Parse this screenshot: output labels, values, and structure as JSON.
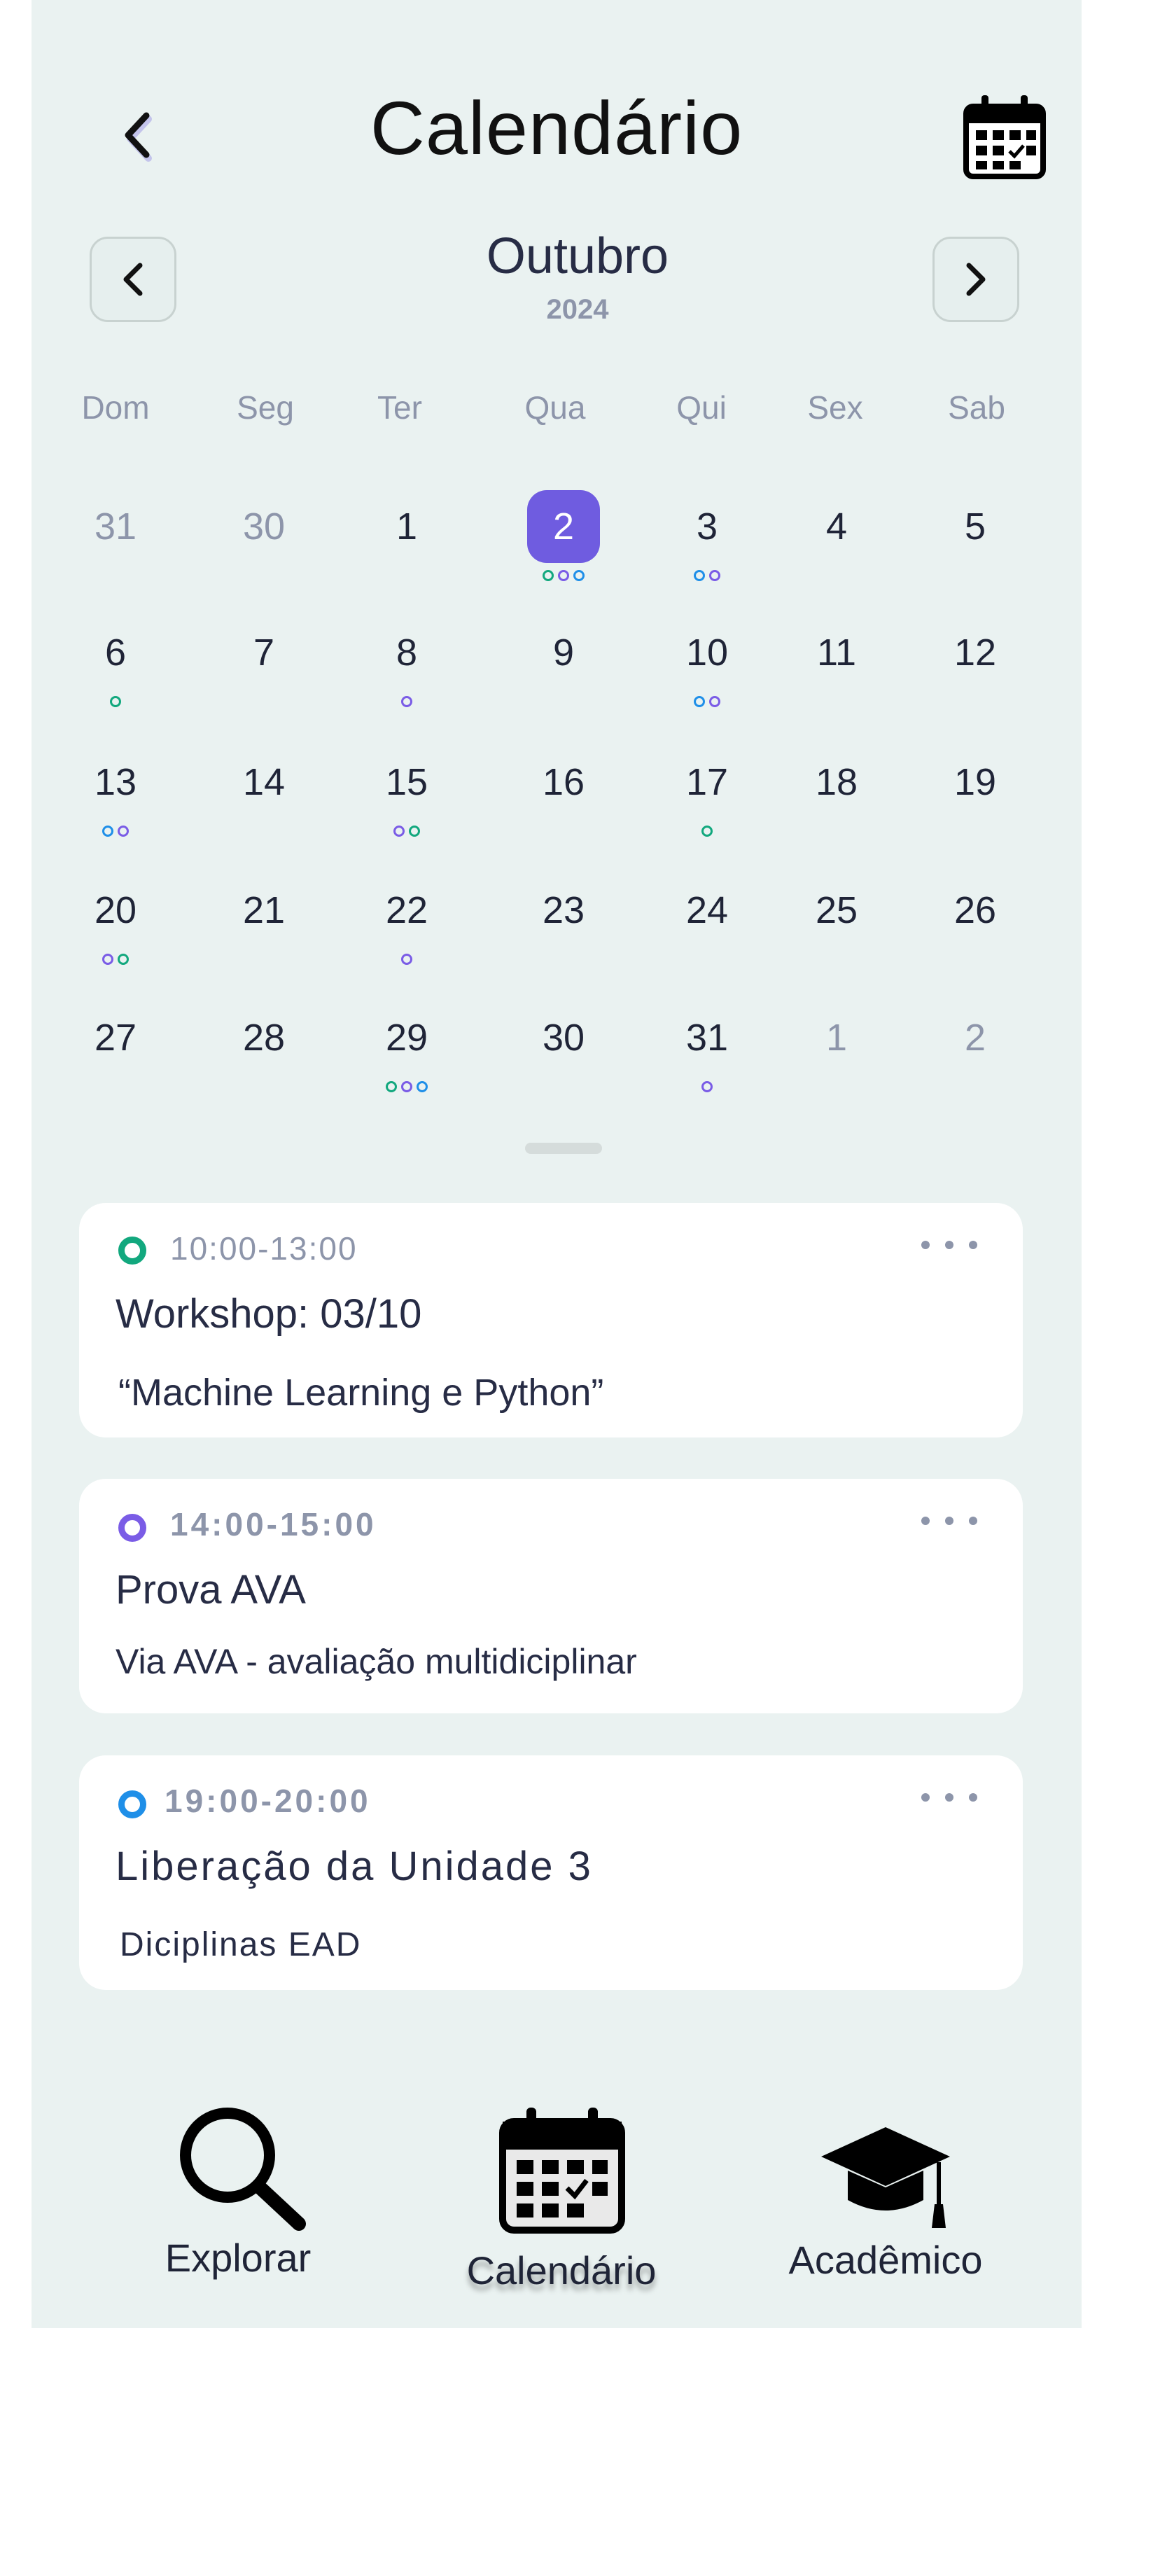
{
  "header": {
    "title": "Calendário",
    "back_icon": "chevron-left-icon",
    "calendar_icon": "calendar-icon"
  },
  "month_nav": {
    "month": "Outubro",
    "year": "2024"
  },
  "weekdays": [
    "Dom",
    "Seg",
    "Ter",
    "Qua",
    "Qui",
    "Sex",
    "Sab"
  ],
  "calendar": {
    "weeks": [
      [
        {
          "d": "31",
          "muted": true
        },
        {
          "d": "30",
          "muted": true
        },
        {
          "d": "1"
        },
        {
          "d": "2",
          "selected": true,
          "dots": [
            "green",
            "purple",
            "blue"
          ]
        },
        {
          "d": "3",
          "dots": [
            "blue",
            "purple"
          ]
        },
        {
          "d": "4"
        },
        {
          "d": "5"
        }
      ],
      [
        {
          "d": "6",
          "dots": [
            "green"
          ]
        },
        {
          "d": "7"
        },
        {
          "d": "8",
          "dots": [
            "purple"
          ]
        },
        {
          "d": "9"
        },
        {
          "d": "10",
          "dots": [
            "blue",
            "purple"
          ]
        },
        {
          "d": "11"
        },
        {
          "d": "12"
        }
      ],
      [
        {
          "d": "13",
          "dots": [
            "blue",
            "purple"
          ]
        },
        {
          "d": "14"
        },
        {
          "d": "15",
          "dots": [
            "purple",
            "green"
          ]
        },
        {
          "d": "16"
        },
        {
          "d": "17",
          "dots": [
            "green"
          ]
        },
        {
          "d": "18"
        },
        {
          "d": "19"
        }
      ],
      [
        {
          "d": "20",
          "dots": [
            "purple",
            "green"
          ]
        },
        {
          "d": "21"
        },
        {
          "d": "22",
          "dots": [
            "purple"
          ]
        },
        {
          "d": "23"
        },
        {
          "d": "24"
        },
        {
          "d": "25"
        },
        {
          "d": "26"
        }
      ],
      [
        {
          "d": "27"
        },
        {
          "d": "28"
        },
        {
          "d": "29",
          "dots": [
            "green",
            "purple",
            "blue"
          ]
        },
        {
          "d": "30"
        },
        {
          "d": "31",
          "dots": [
            "purple"
          ]
        },
        {
          "d": "1",
          "muted": true
        },
        {
          "d": "2",
          "muted": true
        }
      ]
    ]
  },
  "colors": {
    "green": "#12a87e",
    "purple": "#7a5ce6",
    "blue": "#1f8fe8",
    "accent": "#6f5ce0",
    "background": "#eaf2f1"
  },
  "events": [
    {
      "time": "10:00-13:00",
      "title": "Workshop: 03/10",
      "subtitle": "“Machine Learning e Python”",
      "color": "green"
    },
    {
      "time": "14:00-15:00",
      "title": "Prova AVA",
      "subtitle": "Via AVA - avaliação multidiciplinar",
      "color": "purple"
    },
    {
      "time": "19:00-20:00",
      "title": "Liberação da Unidade 3",
      "subtitle": "Diciplinas EAD",
      "color": "blue"
    }
  ],
  "bottom_nav": [
    {
      "label": "Explorar",
      "icon": "search-icon"
    },
    {
      "label": "Calendário",
      "icon": "calendar-icon",
      "active": true
    },
    {
      "label": "Acadêmico",
      "icon": "graduation-cap-icon"
    }
  ]
}
